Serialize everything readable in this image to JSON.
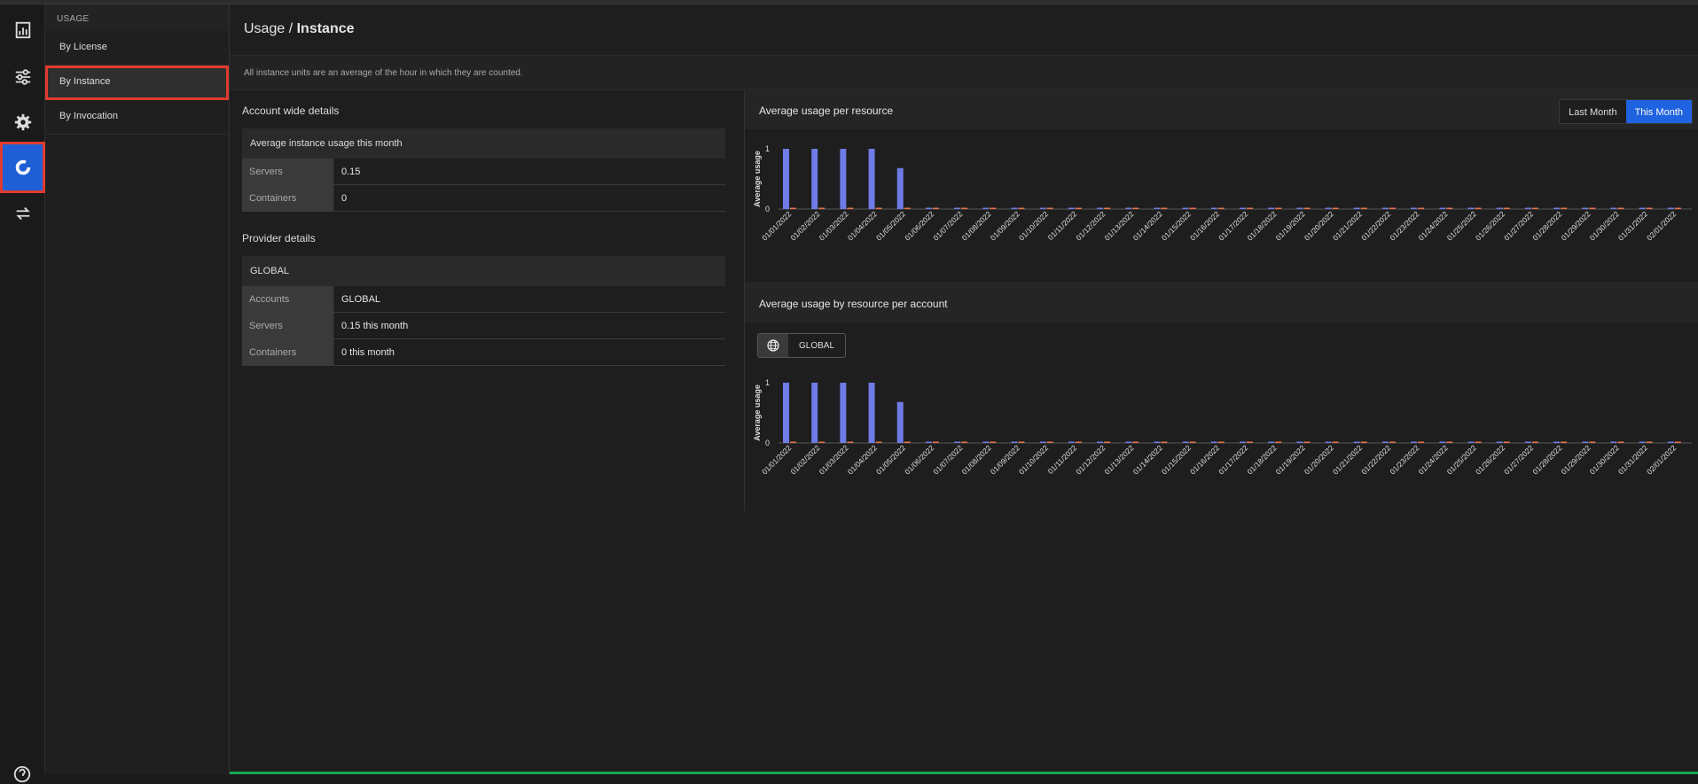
{
  "rail": {
    "icons": [
      "dashboard-icon",
      "sliders-icon",
      "gear-icon",
      "usage-icon",
      "transfer-icon"
    ],
    "help_icon": "help-icon",
    "accent": "#1f5fd6"
  },
  "subnav": {
    "header": "USAGE",
    "items": [
      {
        "label": "By License"
      },
      {
        "label": "By Instance"
      },
      {
        "label": "By Invocation"
      }
    ]
  },
  "page": {
    "title_prefix": "Usage / ",
    "title_main": "Instance",
    "info": "All instance units are an average of the hour in which they are counted."
  },
  "account": {
    "section_title": "Account wide details",
    "card_title": "Average instance usage this month",
    "rows": [
      {
        "key": "Servers",
        "value": "0.15"
      },
      {
        "key": "Containers",
        "value": "0"
      }
    ]
  },
  "provider": {
    "section_title": "Provider details",
    "card_title": "GLOBAL",
    "rows": [
      {
        "key": "Accounts",
        "value": "GLOBAL"
      },
      {
        "key": "Servers",
        "value": "0.15 this month"
      },
      {
        "key": "Containers",
        "value": "0 this month"
      }
    ]
  },
  "panel1": {
    "title": "Average usage per resource",
    "toggle": [
      "Last Month",
      "This Month"
    ],
    "toggle_selected": "This Month"
  },
  "panel2": {
    "title": "Average usage by resource per account",
    "chip_label": "GLOBAL",
    "chip_icon": "globe-icon"
  },
  "chart_data": [
    {
      "type": "bar",
      "ylabel": "Average usage",
      "ylim": [
        0,
        1
      ],
      "yticks": [
        "0",
        "1"
      ],
      "categories": [
        "01/01/2022",
        "01/02/2022",
        "01/03/2022",
        "01/04/2022",
        "01/05/2022",
        "01/06/2022",
        "01/07/2022",
        "01/08/2022",
        "01/09/2022",
        "01/10/2022",
        "01/11/2022",
        "01/12/2022",
        "01/13/2022",
        "01/14/2022",
        "01/15/2022",
        "01/16/2022",
        "01/17/2022",
        "01/18/2022",
        "01/19/2022",
        "01/20/2022",
        "01/21/2022",
        "01/22/2022",
        "01/23/2022",
        "01/24/2022",
        "01/25/2022",
        "01/26/2022",
        "01/27/2022",
        "01/28/2022",
        "01/29/2022",
        "01/30/2022",
        "01/31/2022",
        "02/01/2022"
      ],
      "series": [
        {
          "color": "#6f7be6",
          "values": [
            1,
            1,
            1,
            1,
            0.68,
            0,
            0,
            0,
            0,
            0,
            0,
            0,
            0,
            0,
            0,
            0,
            0,
            0,
            0,
            0,
            0,
            0,
            0,
            0,
            0,
            0,
            0,
            0,
            0,
            0,
            0,
            0
          ]
        },
        {
          "color": "#e8744a",
          "values": [
            0,
            0,
            0,
            0,
            0,
            0,
            0,
            0,
            0,
            0,
            0,
            0,
            0,
            0,
            0,
            0,
            0,
            0,
            0,
            0,
            0,
            0,
            0,
            0,
            0,
            0,
            0,
            0,
            0,
            0,
            0,
            0
          ]
        }
      ]
    },
    {
      "type": "bar",
      "ylabel": "Average usage",
      "ylim": [
        0,
        1
      ],
      "yticks": [
        "0",
        "1"
      ],
      "categories": [
        "01/01/2022",
        "01/02/2022",
        "01/03/2022",
        "01/04/2022",
        "01/05/2022",
        "01/06/2022",
        "01/07/2022",
        "01/08/2022",
        "01/09/2022",
        "01/10/2022",
        "01/11/2022",
        "01/12/2022",
        "01/13/2022",
        "01/14/2022",
        "01/15/2022",
        "01/16/2022",
        "01/17/2022",
        "01/18/2022",
        "01/19/2022",
        "01/20/2022",
        "01/21/2022",
        "01/22/2022",
        "01/23/2022",
        "01/24/2022",
        "01/25/2022",
        "01/26/2022",
        "01/27/2022",
        "01/28/2022",
        "01/29/2022",
        "01/30/2022",
        "01/31/2022",
        "02/01/2022"
      ],
      "series": [
        {
          "color": "#6f7be6",
          "values": [
            1,
            1,
            1,
            1,
            0.68,
            0,
            0,
            0,
            0,
            0,
            0,
            0,
            0,
            0,
            0,
            0,
            0,
            0,
            0,
            0,
            0,
            0,
            0,
            0,
            0,
            0,
            0,
            0,
            0,
            0,
            0,
            0
          ]
        },
        {
          "color": "#e8744a",
          "values": [
            0,
            0,
            0,
            0,
            0,
            0,
            0,
            0,
            0,
            0,
            0,
            0,
            0,
            0,
            0,
            0,
            0,
            0,
            0,
            0,
            0,
            0,
            0,
            0,
            0,
            0,
            0,
            0,
            0,
            0,
            0,
            0
          ]
        }
      ]
    }
  ]
}
